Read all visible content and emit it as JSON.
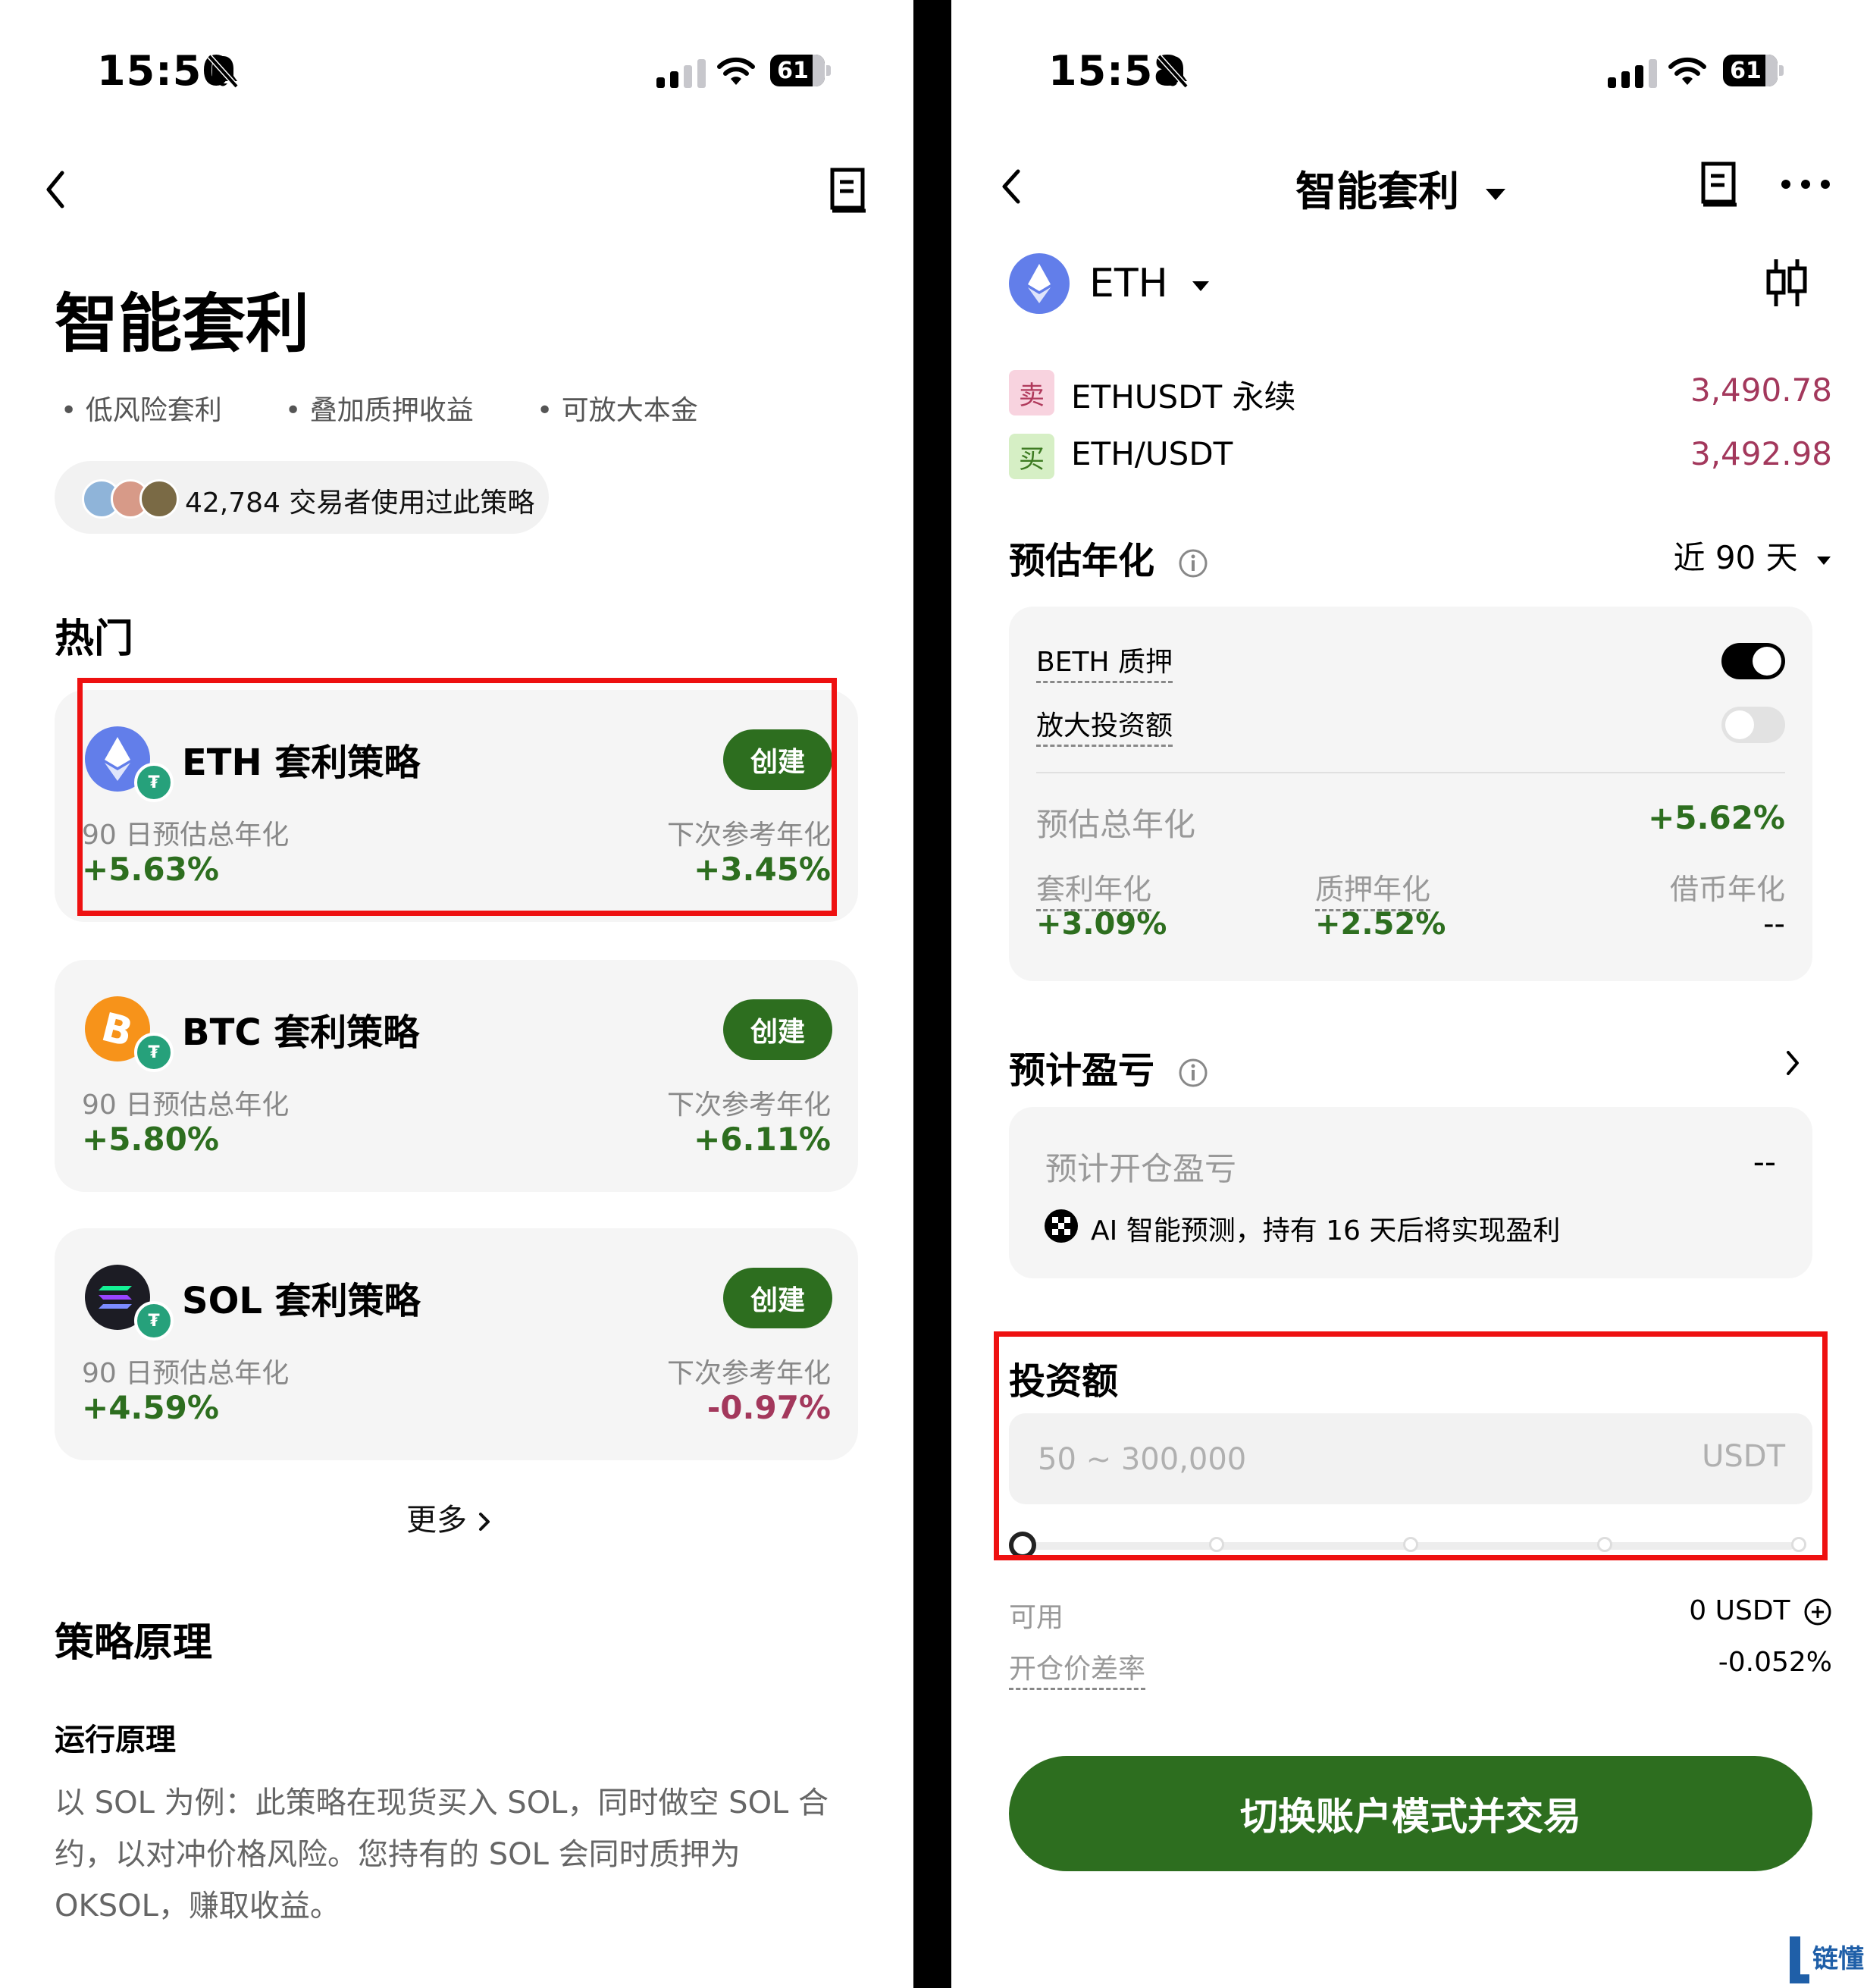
{
  "left": {
    "status": {
      "time": "15:50",
      "battery": "61"
    },
    "title": "智能套利",
    "bullets": [
      "低风险套利",
      "叠加质押收益",
      "可放大本金"
    ],
    "users_text": "42,784 交易者使用过此策略",
    "hot_title": "热门",
    "strategies": [
      {
        "name": "ETH 套利策略",
        "create": "创建",
        "label1": "90 日预估总年化",
        "value1": "+5.63%",
        "label2": "下次参考年化",
        "value2": "+3.45%",
        "coin_color": "#627eea",
        "value2_color": "#2d6e1f"
      },
      {
        "name": "BTC 套利策略",
        "create": "创建",
        "label1": "90 日预估总年化",
        "value1": "+5.80%",
        "label2": "下次参考年化",
        "value2": "+6.11%",
        "coin_color": "#f7931a",
        "value2_color": "#2d6e1f"
      },
      {
        "name": "SOL 套利策略",
        "create": "创建",
        "label1": "90 日预估总年化",
        "value1": "+4.59%",
        "label2": "下次参考年化",
        "value2": "-0.97%",
        "coin_color": "#1c1c24",
        "value2_color": "#a3385c"
      }
    ],
    "more": "更多",
    "principle_title": "策略原理",
    "run_title": "运行原理",
    "run_text": "以 SOL 为例：此策略在现货买入 SOL，同时做空 SOL 合约，以对冲价格风险。您持有的 SOL 会同时质押为 OKSOL，赚取收益。"
  },
  "right": {
    "status": {
      "time": "15:58",
      "battery": "61"
    },
    "header_title": "智能套利",
    "coin": "ETH",
    "pairs": [
      {
        "tag": "卖",
        "name": "ETHUSDT 永续",
        "price": "3,490.78"
      },
      {
        "tag": "买",
        "name": "ETH/USDT",
        "price": "3,492.98"
      }
    ],
    "apy_title": "预估年化",
    "period": "近 90 天",
    "beth_label": "BETH 质押",
    "beth_on": true,
    "amplify_label": "放大投资额",
    "amplify_on": false,
    "total_label": "预估总年化",
    "total_value": "+5.62%",
    "arb_label": "套利年化",
    "arb_value": "+3.09%",
    "stake_label": "质押年化",
    "stake_value": "+2.52%",
    "borrow_label": "借币年化",
    "borrow_value": "--",
    "pnl_title": "预计盈亏",
    "open_pnl_label": "预计开仓盈亏",
    "open_pnl_value": "--",
    "ai_text": "AI 智能预测，持有 16 天后将实现盈利",
    "invest_title": "投资额",
    "invest_placeholder": "50 ~ 300,000",
    "invest_unit": "USDT",
    "slider_value": 0,
    "available_label": "可用",
    "available_value": "0 USDT",
    "spread_label": "开仓价差率",
    "spread_value": "-0.052%",
    "cta": "切换账户模式并交易"
  },
  "watermark": "链懂",
  "colors": {
    "accent_green": "#2d6e1f",
    "price_red": "#a3385c",
    "highlight": "#ee1111"
  }
}
